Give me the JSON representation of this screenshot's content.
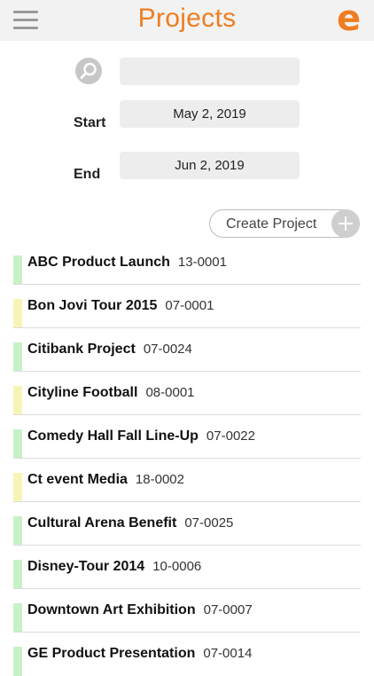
{
  "header": {
    "title": "Projects",
    "logo_text": "e"
  },
  "filters": {
    "search_value": "",
    "start_label": "Start",
    "start_date": "May 2, 2019",
    "end_label": "End",
    "end_date": "Jun 2, 2019"
  },
  "actions": {
    "create_label": "Create Project"
  },
  "colors": {
    "accent": "#f07d1f",
    "status_green": "#c8f1c8",
    "status_yellow": "#f7f4b8"
  },
  "projects": [
    {
      "name": "ABC Product Launch",
      "code": "13-0001",
      "status": "green"
    },
    {
      "name": "Bon Jovi Tour 2015",
      "code": "07-0001",
      "status": "yellow"
    },
    {
      "name": "Citibank Project",
      "code": "07-0024",
      "status": "green"
    },
    {
      "name": "Cityline Football",
      "code": "08-0001",
      "status": "yellow"
    },
    {
      "name": "Comedy Hall Fall Line-Up",
      "code": "07-0022",
      "status": "green"
    },
    {
      "name": "Ct event Media",
      "code": "18-0002",
      "status": "yellow"
    },
    {
      "name": "Cultural Arena Benefit",
      "code": "07-0025",
      "status": "green"
    },
    {
      "name": "Disney-Tour 2014",
      "code": "10-0006",
      "status": "green"
    },
    {
      "name": "Downtown Art Exhibition",
      "code": "07-0007",
      "status": "green"
    },
    {
      "name": "GE Product Presentation",
      "code": "07-0014",
      "status": "green"
    }
  ]
}
